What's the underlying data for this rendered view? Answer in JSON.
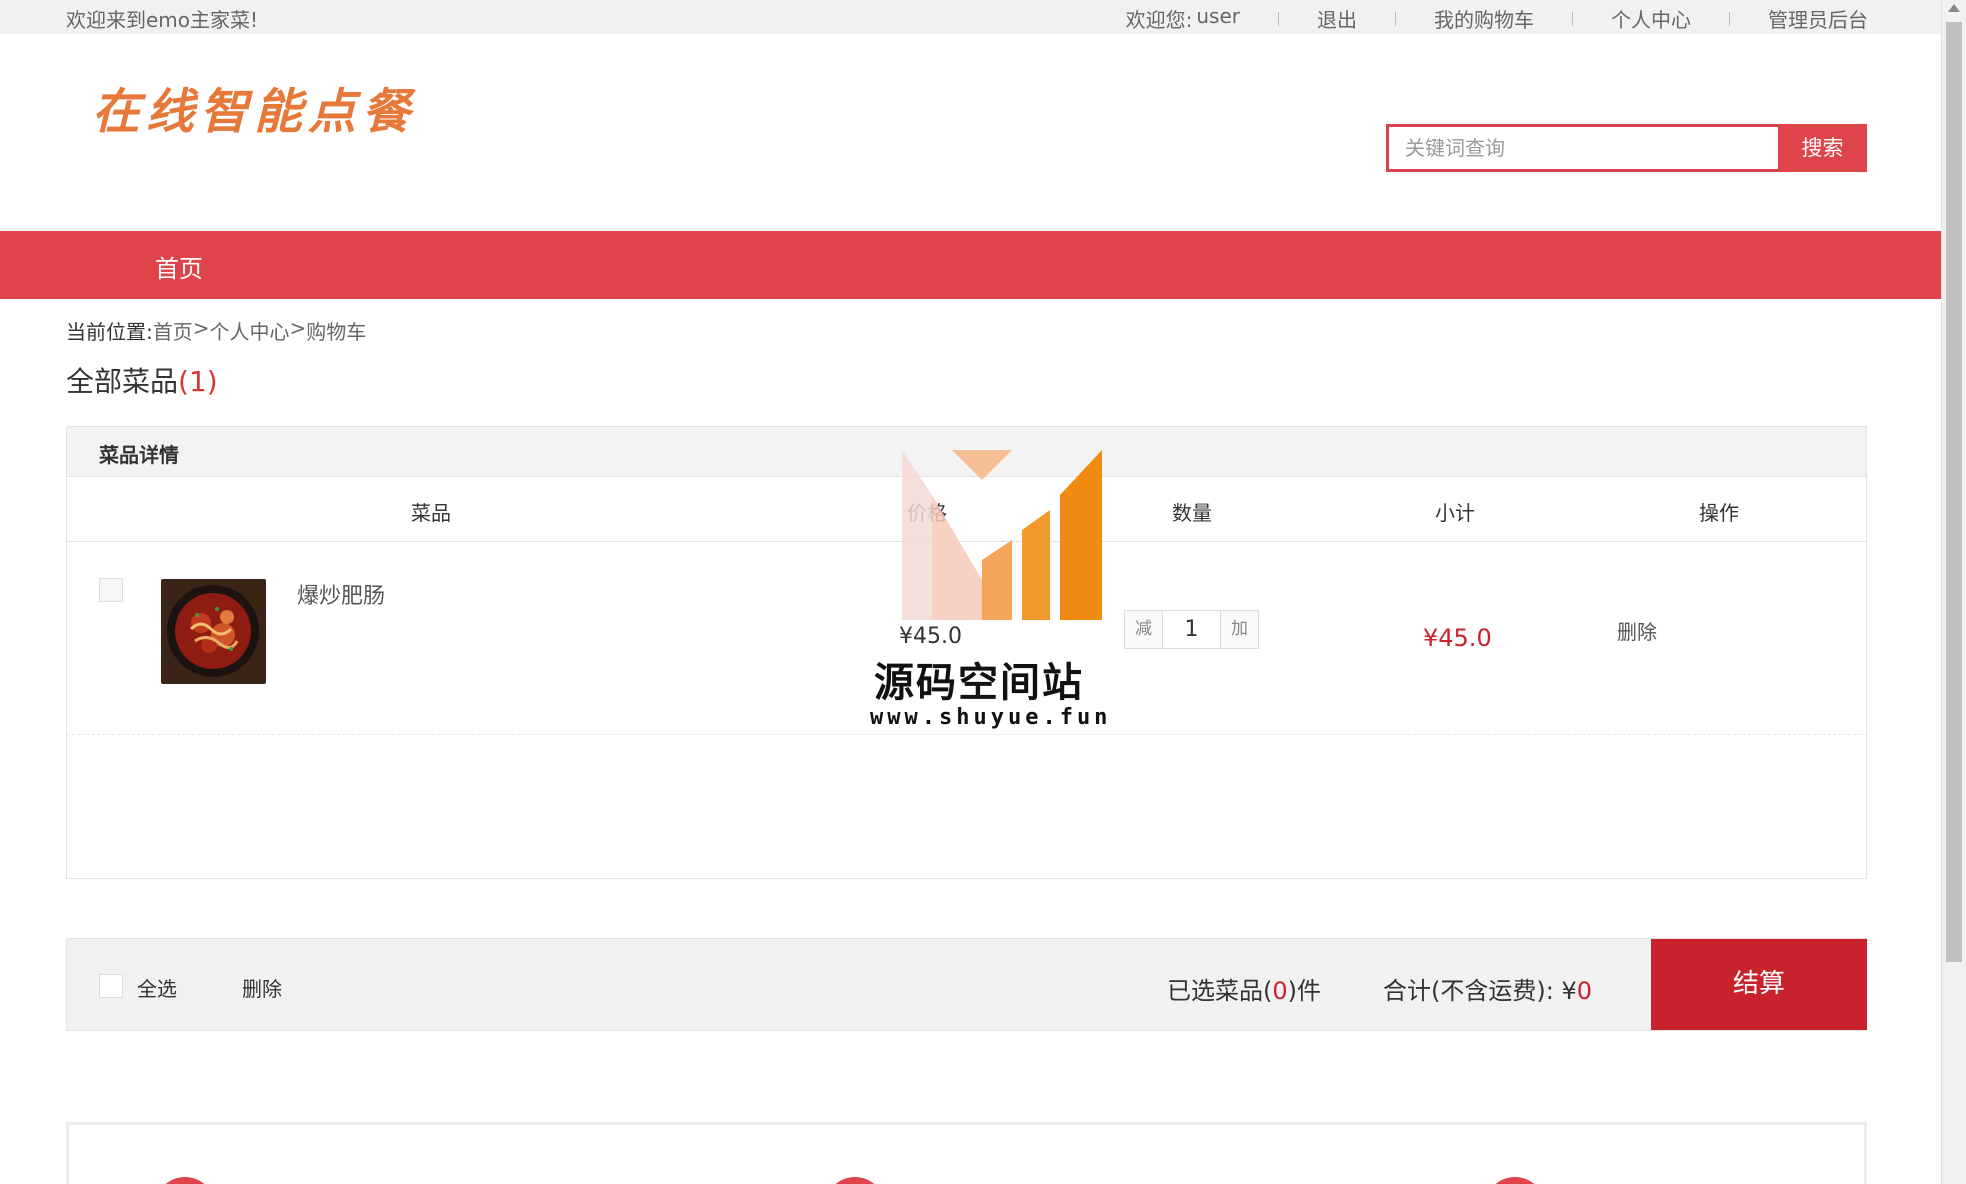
{
  "topbar": {
    "welcome": "欢迎来到emo主家菜!",
    "greeting": "欢迎您:",
    "username": "user",
    "logout": "退出",
    "my_cart": "我的购物车",
    "profile": "个人中心",
    "admin": "管理员后台"
  },
  "header": {
    "logo": "在线智能点餐",
    "search_placeholder": "关键词查询",
    "search_button": "搜索"
  },
  "nav": {
    "home": "首页"
  },
  "breadcrumb": {
    "prefix": "当前位置:",
    "home": "首页",
    "sep1": ">",
    "profile": "个人中心",
    "sep2": ">",
    "cart": "购物车"
  },
  "cart": {
    "title": "全部菜品",
    "count": "(1)",
    "section_label": "菜品详情",
    "columns": {
      "dish": "菜品",
      "price": "价格",
      "quantity": "数量",
      "subtotal": "小计",
      "action": "操作"
    },
    "items": [
      {
        "name": "爆炒肥肠",
        "price": "¥45.0",
        "dec_label": "减",
        "quantity": "1",
        "inc_label": "加",
        "subtotal": "¥45.0",
        "delete": "删除"
      }
    ]
  },
  "summary": {
    "select_all": "全选",
    "delete": "删除",
    "picked_prefix": "已选菜品(",
    "picked_count": "0",
    "picked_suffix": ")件",
    "total_label": "合计(不含运费): ¥",
    "total_value": "0",
    "checkout": "结算"
  },
  "watermark": {
    "site": "源码空间站",
    "url": "www.shuyue.fun"
  },
  "colors": {
    "accent": "#df444a",
    "price_red": "#c8232c",
    "logo_orange": "#e6783a"
  }
}
